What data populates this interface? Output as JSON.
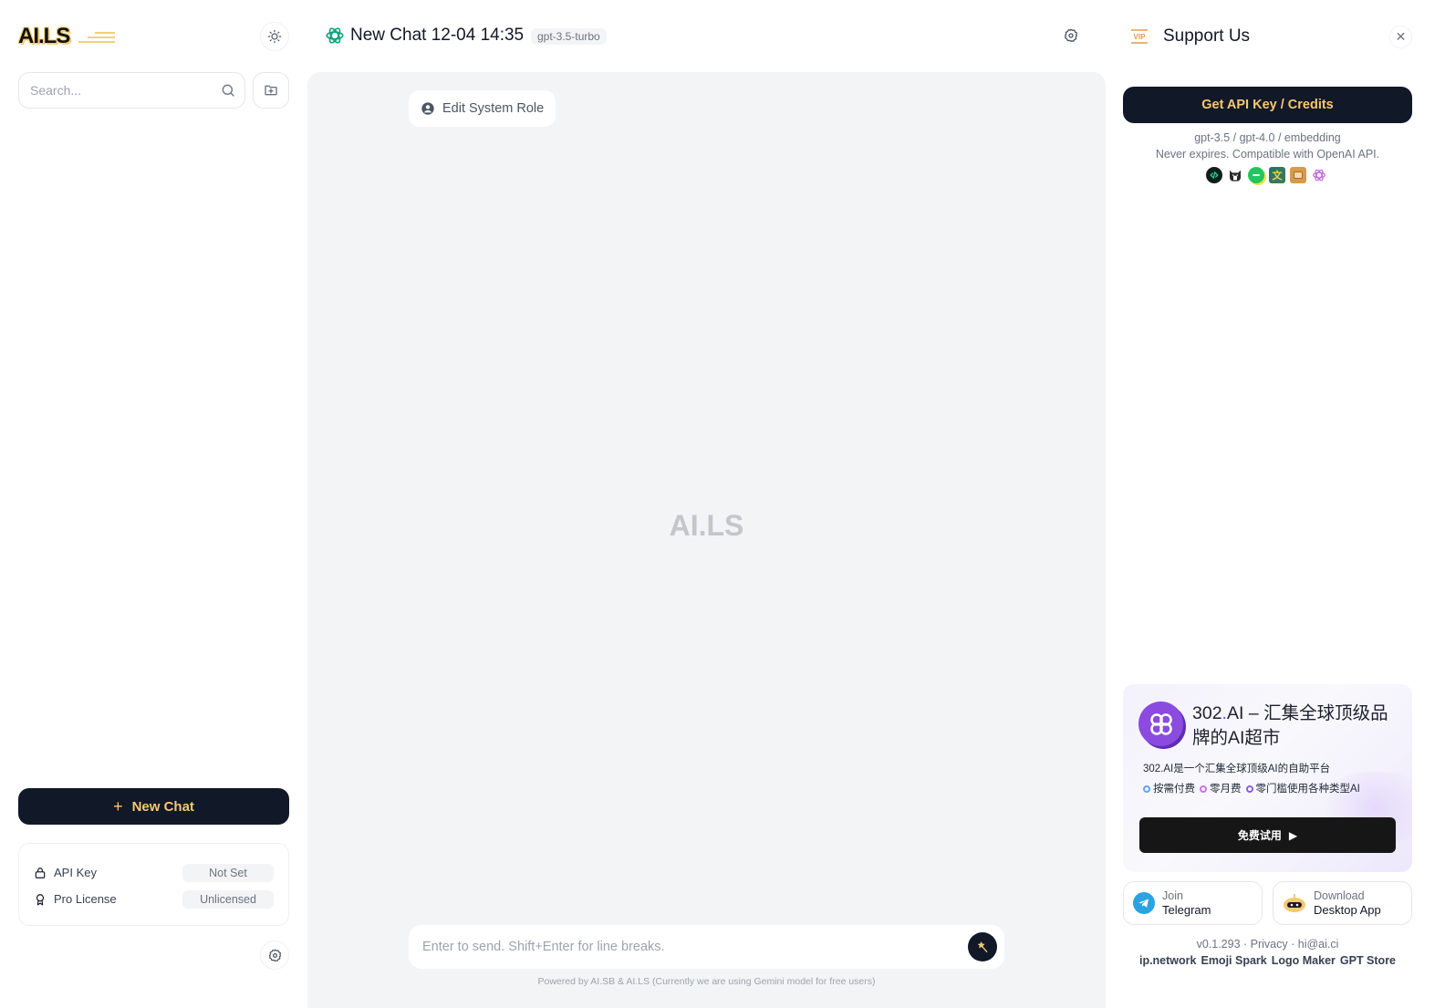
{
  "sidebar": {
    "logo_text": "AI.LS",
    "search_placeholder": "Search...",
    "new_chat_label": "New Chat",
    "status": [
      {
        "label": "API Key",
        "value": "Not Set",
        "icon": "lock-icon"
      },
      {
        "label": "Pro License",
        "value": "Unlicensed",
        "icon": "award-icon"
      }
    ]
  },
  "header": {
    "title": "New Chat 12-04 14:35",
    "model": "gpt-3.5-turbo"
  },
  "chat": {
    "edit_role_label": "Edit System Role",
    "watermark": "AI.LS",
    "input_placeholder": "Enter to send. Shift+Enter for line breaks.",
    "powered_by": "Powered by AI.SB & AI.LS (Currently we are using Gemini model for free users)"
  },
  "support": {
    "title": "Support Us",
    "vip_badge": "VIP",
    "api_button": "Get API Key / Credits",
    "api_line1": "gpt-3.5 / gpt-4.0 / embedding",
    "api_line2": "Never expires. Compatible with OpenAI API.",
    "app_icons": [
      "code-app-icon",
      "cat-app-icon",
      "chat-bubble-app-icon",
      "translate-app-icon",
      "message-app-icon",
      "openai-app-icon"
    ],
    "promo": {
      "brand": "302",
      "brand_dot": ".",
      "brand_suffix": "AI",
      "title_rest": " – 汇集全球顶级品牌的AI超市",
      "description": "302.AI是一个汇集全球顶级AI的自助平台",
      "tags": [
        {
          "label": "按需付费",
          "color": "#60a5fa"
        },
        {
          "label": "零月费",
          "color": "#d070e8"
        },
        {
          "label": "零门槛使用各种类型AI",
          "color": "#8b5cf6"
        }
      ],
      "button": "免费试用",
      "button_arrow": "▶"
    },
    "telegram": {
      "line1": "Join",
      "line2": "Telegram"
    },
    "download": {
      "line1": "Download",
      "line2": "Desktop App"
    },
    "footer": {
      "version": "v0.1.293",
      "sep": " · ",
      "privacy": "Privacy",
      "email": "hi@ai.ci",
      "links": [
        "ip.network",
        "Emoji Spark",
        "Logo Maker",
        "GPT Store"
      ]
    }
  },
  "colors": {
    "accent": "#f5c872",
    "dark": "#111827",
    "openai_green": "#10a37f",
    "promo_purple": "#8b4be0"
  }
}
